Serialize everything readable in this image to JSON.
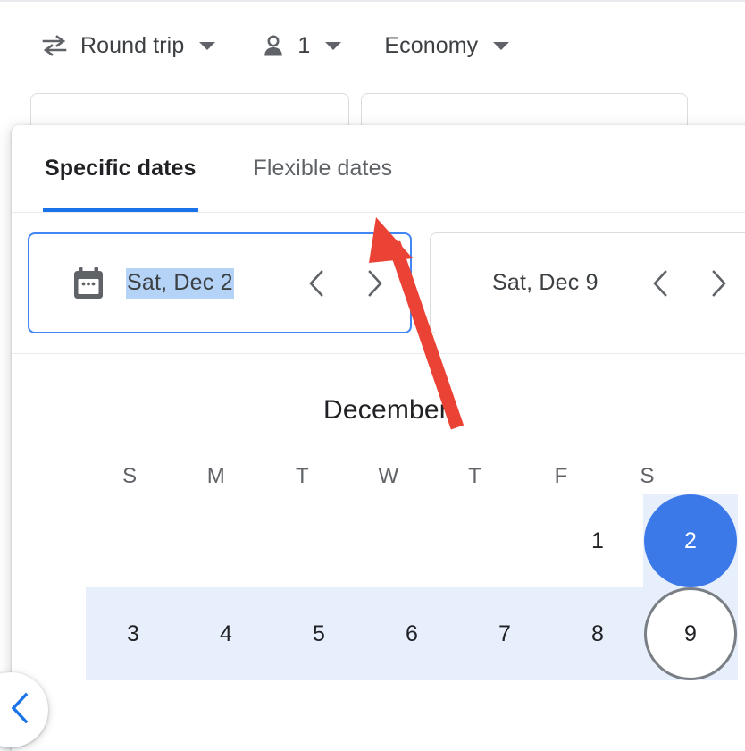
{
  "toolbar": {
    "trip_type": {
      "label": "Round trip",
      "icon": "swap-horizontal-icon"
    },
    "passengers": {
      "label": "1",
      "icon": "person-icon"
    },
    "cabin_class": {
      "label": "Economy"
    }
  },
  "dialog": {
    "tabs": [
      {
        "label": "Specific dates",
        "active": true
      },
      {
        "label": "Flexible dates",
        "active": false
      }
    ],
    "departure": {
      "icon": "calendar-icon",
      "value": "Sat, Dec 2",
      "selected_text": true,
      "prev_icon": "chevron-left-icon",
      "next_icon": "chevron-right-icon"
    },
    "return": {
      "value": "Sat, Dec 9",
      "prev_icon": "chevron-left-icon",
      "next_icon": "chevron-right-icon"
    },
    "calendar": {
      "month": "December",
      "weekdays": [
        "S",
        "M",
        "T",
        "W",
        "T",
        "F",
        "S"
      ],
      "weeks": [
        [
          {
            "day": "",
            "state": "empty",
            "band": "none"
          },
          {
            "day": "",
            "state": "empty",
            "band": "none"
          },
          {
            "day": "",
            "state": "empty",
            "band": "none"
          },
          {
            "day": "",
            "state": "empty",
            "band": "none"
          },
          {
            "day": "",
            "state": "empty",
            "band": "none"
          },
          {
            "day": "1",
            "state": "normal",
            "band": "none"
          },
          {
            "day": "2",
            "state": "selected",
            "band": "full"
          }
        ],
        [
          {
            "day": "3",
            "state": "normal",
            "band": "full"
          },
          {
            "day": "4",
            "state": "normal",
            "band": "full"
          },
          {
            "day": "5",
            "state": "normal",
            "band": "full"
          },
          {
            "day": "6",
            "state": "normal",
            "band": "full"
          },
          {
            "day": "7",
            "state": "normal",
            "band": "full"
          },
          {
            "day": "8",
            "state": "normal",
            "band": "full"
          },
          {
            "day": "9",
            "state": "outlined",
            "band": "full"
          }
        ]
      ],
      "selected_start": "2",
      "selected_end": "9"
    }
  },
  "back_button": {
    "icon": "chevron-left-icon",
    "label": ""
  },
  "colors": {
    "accent_blue": "#1a73e8",
    "selected_day": "#3b78e8",
    "range_band": "#e7eefc",
    "text_selection": "#b5d3f6",
    "focus_border": "#4285f4",
    "annotation_red": "#ea4335",
    "text_primary": "#202124",
    "text_secondary": "#5f6368",
    "border_gray": "#dadce0"
  }
}
